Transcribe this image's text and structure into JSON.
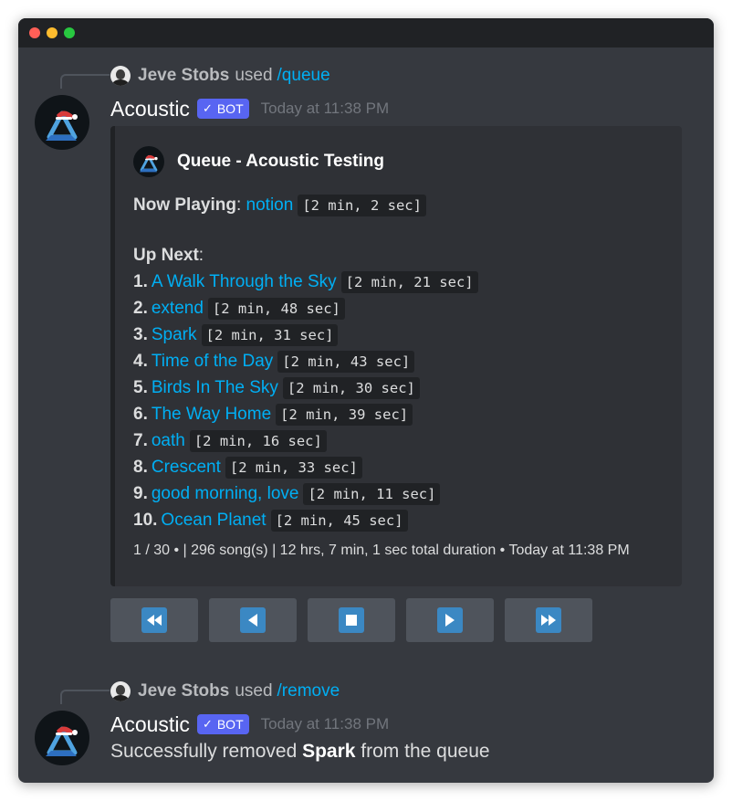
{
  "messages": [
    {
      "reply": {
        "user": "Jeve Stobs",
        "used": "used",
        "command": "/queue"
      },
      "author": "Acoustic",
      "bot_tag": "BOT",
      "timestamp": "Today at 11:38 PM",
      "embed": {
        "title": "Queue - Acoustic Testing",
        "now_playing_label": "Now Playing",
        "now_playing_title": "notion",
        "now_playing_duration": "[2 min, 2 sec]",
        "up_next_label": "Up Next",
        "queue": [
          {
            "num": "1.",
            "title": "A Walk Through the Sky",
            "duration": "[2 min, 21 sec]"
          },
          {
            "num": "2.",
            "title": "extend",
            "duration": "[2 min, 48 sec]"
          },
          {
            "num": "3.",
            "title": "Spark",
            "duration": "[2 min, 31 sec]"
          },
          {
            "num": "4.",
            "title": "Time of the Day",
            "duration": "[2 min, 43 sec]"
          },
          {
            "num": "5.",
            "title": "Birds In The Sky",
            "duration": "[2 min, 30 sec]"
          },
          {
            "num": "6.",
            "title": "The Way Home",
            "duration": "[2 min, 39 sec]"
          },
          {
            "num": "7.",
            "title": "oath",
            "duration": "[2 min, 16 sec]"
          },
          {
            "num": "8.",
            "title": "Crescent",
            "duration": "[2 min, 33 sec]"
          },
          {
            "num": "9.",
            "title": "good morning, love",
            "duration": "[2 min, 11 sec]"
          },
          {
            "num": "10.",
            "title": "Ocean Planet",
            "duration": "[2 min, 45 sec]"
          }
        ],
        "footer": "1 / 30 • | 296 song(s) | 12 hrs, 7 min, 1 sec total duration • Today at 11:38 PM"
      },
      "controls": [
        {
          "icon": "fast-backward-icon"
        },
        {
          "icon": "previous-icon"
        },
        {
          "icon": "stop-icon"
        },
        {
          "icon": "play-icon"
        },
        {
          "icon": "fast-forward-icon"
        }
      ]
    },
    {
      "reply": {
        "user": "Jeve Stobs",
        "used": "used",
        "command": "/remove"
      },
      "author": "Acoustic",
      "bot_tag": "BOT",
      "timestamp": "Today at 11:38 PM",
      "text_prefix": "Successfully removed ",
      "text_bold": "Spark",
      "text_suffix": " from the queue"
    }
  ],
  "colors": {
    "background": "#36393f",
    "embed_background": "#2f3136",
    "link": "#00aff4",
    "bot_tag": "#5865f2",
    "button": "#4f545c",
    "button_icon": "#3b88c3"
  }
}
